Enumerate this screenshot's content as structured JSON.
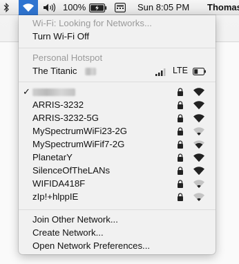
{
  "menubar": {
    "battery_percent": "100%",
    "datetime": "Sun 8:05 PM",
    "user": "Thomas"
  },
  "menu": {
    "status": "Wi-Fi: Looking for Networks...",
    "toggle": "Turn Wi-Fi Off",
    "hotspot_header": "Personal Hotspot",
    "hotspot_name": "The Titanic",
    "hotspot_net": "LTE",
    "networks": [
      {
        "name": "ARRIS-3232",
        "locked": true,
        "strength": 3
      },
      {
        "name": "ARRIS-3232-5G",
        "locked": true,
        "strength": 3
      },
      {
        "name": "MySpectrumWiFi23-2G",
        "locked": true,
        "strength": 1
      },
      {
        "name": "MySpectrumWiFif7-2G",
        "locked": true,
        "strength": 2
      },
      {
        "name": "PlanetarY",
        "locked": true,
        "strength": 3
      },
      {
        "name": "SilenceOfTheLANs",
        "locked": true,
        "strength": 3
      },
      {
        "name": "WIFIDA418F",
        "locked": true,
        "strength": 1
      },
      {
        "name": "zIp!+hlppIE",
        "locked": true,
        "strength": 1
      }
    ],
    "join_other": "Join Other Network...",
    "create": "Create Network...",
    "preferences": "Open Network Preferences..."
  }
}
